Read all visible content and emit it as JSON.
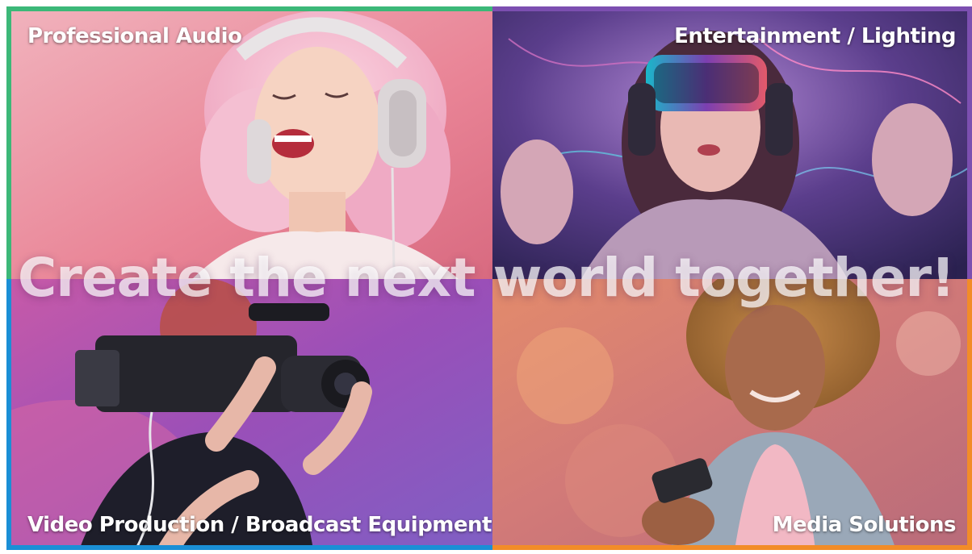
{
  "headline": "Create the next world together!",
  "sections": {
    "professional_audio": {
      "label": "Professional Audio"
    },
    "entertainment_lighting": {
      "label": "Entertainment / Lighting"
    },
    "video_broadcast": {
      "label": "Video Production / Broadcast Equipment"
    },
    "media_solutions": {
      "label": "Media Solutions"
    }
  },
  "colors": {
    "frame_audio": "#3cb878",
    "frame_entertainment": "#7c4fb0",
    "frame_video": "#1a8fd6",
    "frame_media": "#f28c28",
    "label_text": "#ffffff"
  },
  "icons": {
    "audio": "headphones-photo",
    "entertainment": "vr-headset-photo",
    "video": "camcorder-photo",
    "media": "smartphone-photo"
  }
}
